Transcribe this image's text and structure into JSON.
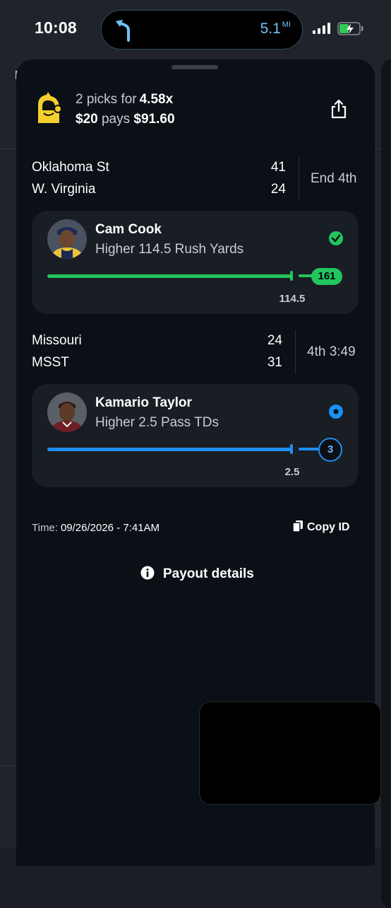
{
  "status_bar": {
    "time": "10:08",
    "navigation": {
      "distance": "5.1",
      "unit": "MI",
      "icon": "turn-left-arrow-icon"
    },
    "signal_icon": "cellular-signal-icon",
    "battery_icon": "battery-charging-icon"
  },
  "entry": {
    "picks_count": "2 picks for",
    "multiplier": "4.58x",
    "stake": "$20",
    "pays_word": "pays",
    "payout": "$91.60",
    "logo_icon": "team-logo-icon",
    "share_icon": "share-icon"
  },
  "games": [
    {
      "home_team": "Oklahoma St",
      "home_score": "41",
      "away_team": "W. Virginia",
      "away_score": "24",
      "status": "End 4th",
      "pick": {
        "player": "Cam Cook",
        "direction_line": "Higher 114.5 Rush Yards",
        "status_icon": "check-circle-icon",
        "result": "161",
        "line": "114.5",
        "progress_fraction": 1.0,
        "accent_color": "#22c55e"
      }
    },
    {
      "home_team": "Missouri",
      "home_score": "24",
      "away_team": "MSST",
      "away_score": "31",
      "status": "4th 3:49",
      "pick": {
        "player": "Kamario Taylor",
        "direction_line": "Higher 2.5 Pass TDs",
        "status_icon": "live-dot-icon",
        "result": "3",
        "line": "2.5",
        "progress_fraction": 1.0,
        "accent_color": "#1d8ff0"
      }
    }
  ],
  "footer": {
    "time_label": "Time:",
    "time_value": "09/26/2026 - 7:41AM",
    "copy_id_label": "Copy ID",
    "payout_details_label": "Payout details"
  }
}
